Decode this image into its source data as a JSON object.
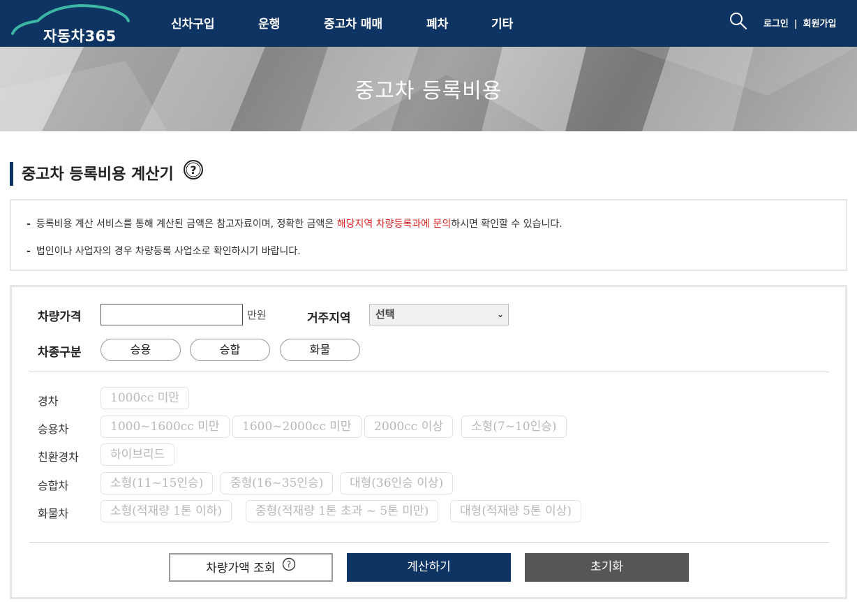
{
  "header": {
    "logo": "자동차365",
    "nav": [
      "신차구입",
      "운행",
      "중고차 매매",
      "폐차",
      "기타"
    ],
    "login": "로그인",
    "separator": "|",
    "signup": "회원가입"
  },
  "hero": {
    "title": "중고차 등록비용"
  },
  "section": {
    "title": "중고차 등록비용 계산기"
  },
  "notice": {
    "dash": "-",
    "line1_before": "등록비용 계산 서비스를 통해 계산된 금액은 참고자료이며, 정확한 금액은 ",
    "line1_highlight": "해당지역 차량등록과에 문의",
    "line1_after": "하시면 확인할 수 있습니다.",
    "line2": "법인이나 사업자의 경우 차량등록 사업소로 확인하시기 바랍니다.",
    "highlight_color": "#d92222"
  },
  "form": {
    "price_label": "차량가격",
    "price_value": "",
    "price_unit": "만원",
    "region_label": "거주지역",
    "region_selected": "선택",
    "type_label": "차종구분",
    "vehicle_types": [
      "승용",
      "승합",
      "화물"
    ]
  },
  "categories": [
    {
      "label": "경차",
      "options": [
        "1000cc 미만"
      ]
    },
    {
      "label": "승용차",
      "options": [
        "1000~1600cc 미만",
        "1600~2000cc 미만",
        "2000cc 이상",
        "소형(7~10인승)"
      ]
    },
    {
      "label": "친환경차",
      "options": [
        "하이브리드"
      ]
    },
    {
      "label": "승합차",
      "options": [
        "소형(11~15인승)",
        "중형(16~35인승)",
        "대형(36인승 이상)"
      ]
    },
    {
      "label": "화물차",
      "options": [
        "소형(적재량 1톤 이하)",
        "중형(적재량 1톤 초과 ~ 5톤 미만)",
        "대형(적재량 5톤 이상)"
      ]
    }
  ],
  "buttons": {
    "price_lookup": "차량가액 조회",
    "calculate": "계산하기",
    "reset": "초기화"
  },
  "colors": {
    "brand": "#0d3462",
    "reset_button": "#565656"
  }
}
